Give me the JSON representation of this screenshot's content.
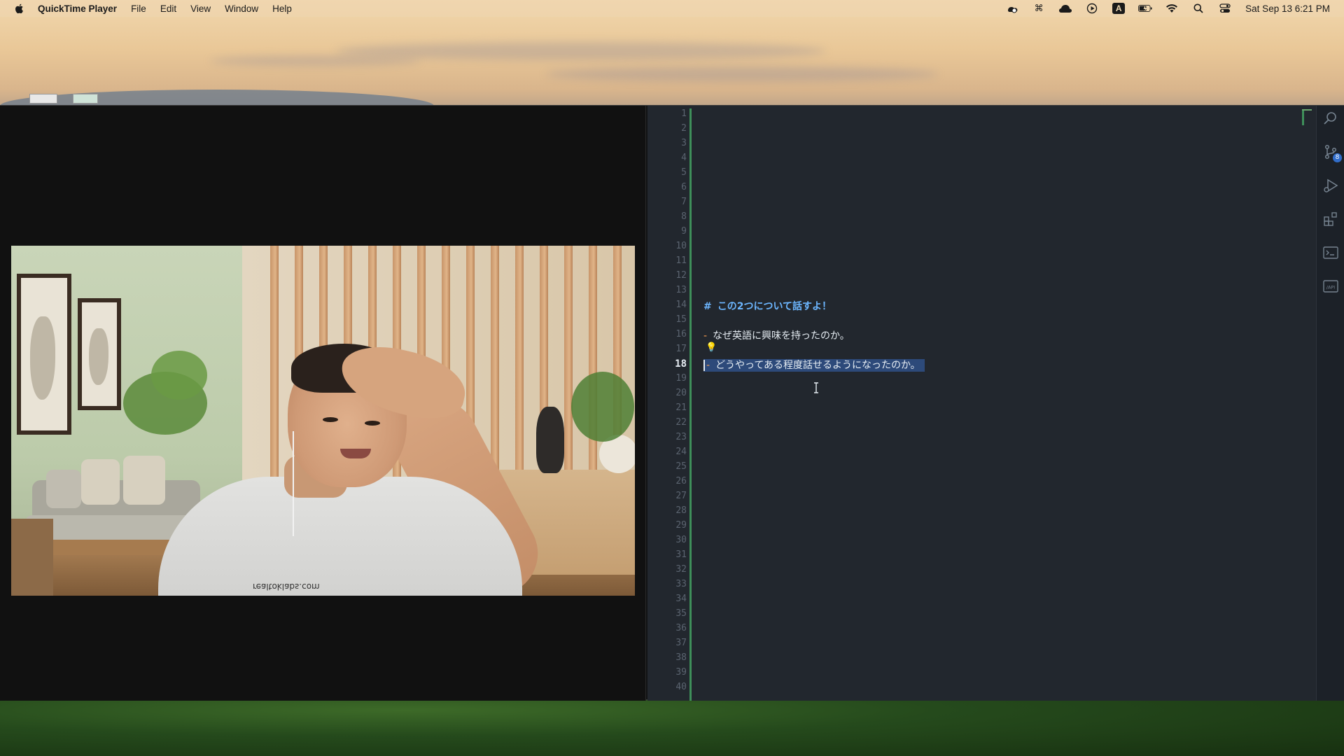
{
  "menubar": {
    "app_name": "QuickTime Player",
    "items": [
      "File",
      "Edit",
      "View",
      "Window",
      "Help"
    ],
    "clock": "Sat Sep 13  6:21 PM",
    "status_icons": [
      "app-indicator-icon",
      "command-icon",
      "cloud-icon",
      "play-circle-icon",
      "keyboard-input-icon",
      "battery-icon",
      "wifi-icon",
      "spotlight-search-icon",
      "control-center-icon"
    ],
    "input_source_label": "A"
  },
  "video": {
    "shirt_text": "realtoklabs.com"
  },
  "editor": {
    "line_count": 40,
    "active_line": 18,
    "lines": {
      "14": "この2つについて話すよ！",
      "16": "なぜ英語に興味を持ったのか。",
      "18": "どうやってある程度話せるようになったのか。"
    },
    "heading_marker": "#",
    "list_marker": "-",
    "accent_color": "#3e8f5a",
    "selection_color": "#2d4a7a"
  },
  "activity_bar": {
    "items": [
      "search-icon",
      "source-control-icon",
      "run-debug-icon",
      "extensions-icon",
      "terminal-icon",
      "api-icon"
    ],
    "source_control_badge": "8",
    "api_label": "/API"
  }
}
